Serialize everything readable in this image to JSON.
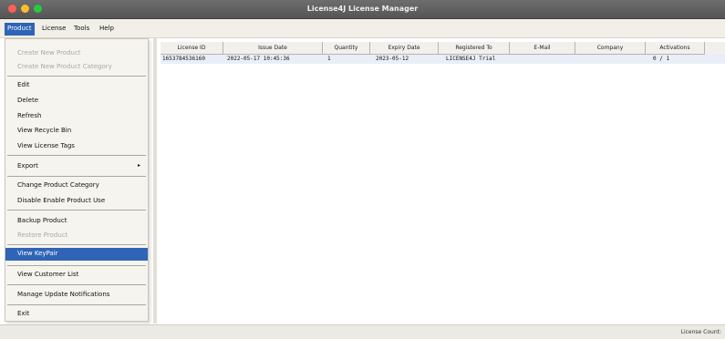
{
  "window": {
    "title": "License4J License Manager"
  },
  "menubar": {
    "items": [
      {
        "label": "Product"
      },
      {
        "label": "License"
      },
      {
        "label": "Tools"
      },
      {
        "label": "Help"
      }
    ]
  },
  "product_menu": {
    "items": [
      {
        "label": "Create New Product",
        "enabled": false
      },
      {
        "label": "Create New Product Category",
        "enabled": false
      },
      {
        "label": "Edit",
        "enabled": true
      },
      {
        "label": "Delete",
        "enabled": true
      },
      {
        "label": "Refresh",
        "enabled": true
      },
      {
        "label": "View Recycle Bin",
        "enabled": true
      },
      {
        "label": "View License Tags",
        "enabled": true
      },
      {
        "label": "Export",
        "enabled": true,
        "has_submenu": true
      },
      {
        "label": "Change Product Category",
        "enabled": true
      },
      {
        "label": "Disable Enable Product Use",
        "enabled": true
      },
      {
        "label": "Backup Product",
        "enabled": true
      },
      {
        "label": "Restore Product",
        "enabled": false
      },
      {
        "label": "View KeyPair",
        "enabled": true,
        "selected": true
      },
      {
        "label": "View Customer List",
        "enabled": true
      },
      {
        "label": "Manage Update Notifications",
        "enabled": true
      },
      {
        "label": "Exit",
        "enabled": true
      }
    ],
    "submenu_arrow": "▸"
  },
  "license_table": {
    "columns": [
      "License ID",
      "Issue Date",
      "Quantity",
      "Expiry Date",
      "Registered To",
      "E-Mail",
      "Company",
      "Activations"
    ],
    "rows": [
      [
        "1653784536160",
        "2022-05-17 10:45:36",
        "1",
        "2023-05-12",
        "LICENSE4J Trial",
        "",
        "",
        "0 / 1"
      ]
    ]
  },
  "status": {
    "text": "License Count:"
  }
}
